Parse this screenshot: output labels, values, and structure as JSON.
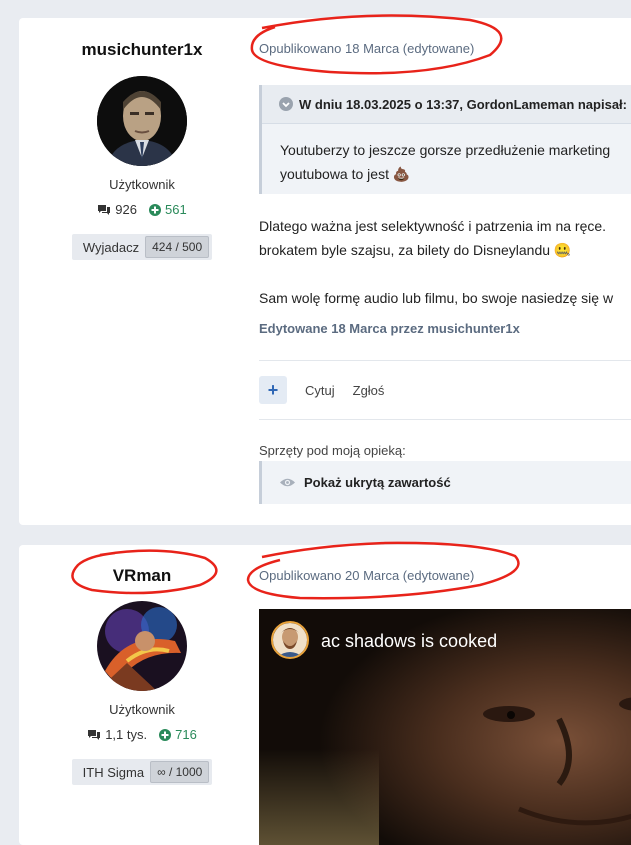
{
  "posts": [
    {
      "author": {
        "username": "musichunter1x",
        "role": "Użytkownik",
        "posts_count": "926",
        "reputation": "561",
        "rank_title": "Wyjadacz",
        "rank_value": "424 / 500"
      },
      "posted": "Opublikowano 18 Marca (edytowane)",
      "quote": {
        "header": "W dniu 18.03.2025 o 13:37, GordonLameman napisał:",
        "line1": "Youtuberzy to jeszcze gorsze przedłużenie marketing",
        "line2": "youtubowa to jest 💩"
      },
      "body": {
        "line1": "Dlatego ważna jest selektywność i patrzenia im na ręce.",
        "line2": "brokatem byle szajsu, za bilety do Disneylandu 🤐",
        "line3": "Sam wolę formę audio lub filmu, bo swoje nasiedzę się w"
      },
      "edited": "Edytowane 18 Marca przez musichunter1x",
      "actions": {
        "quote": "Cytuj",
        "report": "Zgłoś"
      },
      "signature": {
        "label": "Sprzęty pod moją opieką:",
        "spoiler": "Pokaż ukrytą zawartość"
      }
    },
    {
      "author": {
        "username": "VRman",
        "role": "Użytkownik",
        "posts_count": "1,1 tys.",
        "reputation": "716",
        "rank_title": "ITH Sigma",
        "rank_value": "∞ / 1000"
      },
      "posted": "Opublikowano 20 Marca (edytowane)",
      "media": {
        "title": "ac shadows is cooked"
      }
    }
  ],
  "colors": {
    "annotation": "#e8231a",
    "accent": "#2f67b5",
    "positive": "#2a8a5a"
  }
}
